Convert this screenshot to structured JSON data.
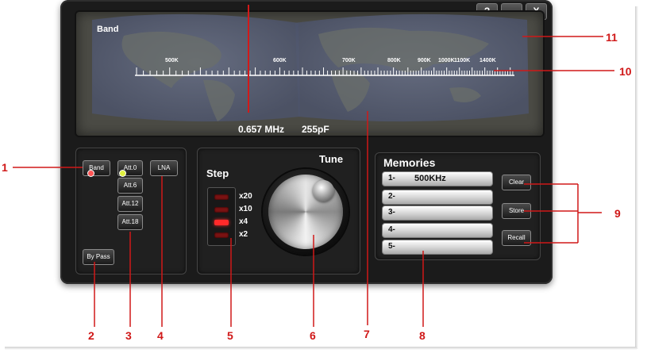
{
  "window": {
    "help_label": "?",
    "minimize_label": "—",
    "close_label": "X"
  },
  "display": {
    "band_label": "Band",
    "frequency": "0.657 MHz",
    "capacitance": "255pF",
    "scale_labels": [
      "500K",
      "600K",
      "700K",
      "800K",
      "900K",
      "1000K",
      "1100K",
      "1400K"
    ]
  },
  "attenuation": {
    "band_button": "Band",
    "att_buttons": [
      "Att.0",
      "Att.6",
      "Att.12",
      "Att.18"
    ],
    "lna_button": "LNA",
    "bypass_button": "By Pass"
  },
  "step": {
    "title": "Step",
    "levels": [
      "x20",
      "x10",
      "x4",
      "x2"
    ],
    "active_level": "x4"
  },
  "tune": {
    "title": "Tune"
  },
  "memories": {
    "title": "Memories",
    "slots": [
      {
        "number": "1-",
        "value": "500KHz"
      },
      {
        "number": "2-",
        "value": ""
      },
      {
        "number": "3-",
        "value": ""
      },
      {
        "number": "4-",
        "value": ""
      },
      {
        "number": "5-",
        "value": ""
      }
    ],
    "clear_button": "Clear",
    "store_button": "Store",
    "recall_button": "Recall"
  },
  "callouts": [
    "1",
    "2",
    "3",
    "4",
    "5",
    "6",
    "7",
    "8",
    "9",
    "10",
    "11"
  ],
  "colors": {
    "callout": "#d01818",
    "led_on": "#ff2a2a",
    "led_off": "#7a1212",
    "indicator_green": "#e0f040",
    "indicator_red": "#ff5555"
  }
}
